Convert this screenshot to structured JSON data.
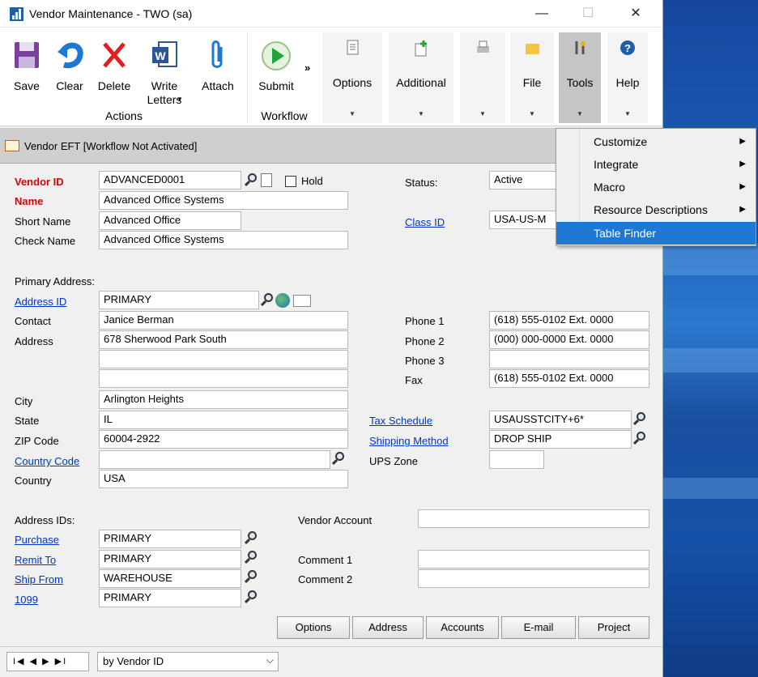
{
  "window": {
    "title": "Vendor Maintenance  -  TWO (sa)",
    "min": "—",
    "max": "☐",
    "close": "✕"
  },
  "ribbon": {
    "save": "Save",
    "clear": "Clear",
    "delete": "Delete",
    "write_letters": "Write Letters",
    "attach": "Attach",
    "actions_group": "Actions",
    "submit": "Submit",
    "workflow_group": "Workflow",
    "more": "»",
    "options": "Options",
    "additional": "Additional",
    "file": "File",
    "tools": "Tools",
    "help": "Help"
  },
  "status_bar": {
    "text": "Vendor EFT [Workflow Not Activated]"
  },
  "form": {
    "vendor_id_label": "Vendor ID",
    "vendor_id": "ADVANCED0001",
    "hold_label": "Hold",
    "name_label": "Name",
    "name": "Advanced Office Systems",
    "short_name_label": "Short Name",
    "short_name": "Advanced Office",
    "check_name_label": "Check Name",
    "check_name": "Advanced Office Systems",
    "status_label": "Status:",
    "status": "Active",
    "class_id_label": "Class ID",
    "class_id": "USA-US-M",
    "primary_address_label": "Primary Address:",
    "address_id_label": "Address ID",
    "address_id": "PRIMARY",
    "contact_label": "Contact",
    "contact": "Janice Berman",
    "address_label": "Address",
    "address1": "678 Sherwood Park South",
    "address2": "",
    "address3": "",
    "city_label": "City",
    "city": "Arlington Heights",
    "state_label": "State",
    "state": "IL",
    "zip_label": "ZIP Code",
    "zip": "60004-2922",
    "country_code_label": "Country Code",
    "country_code": "",
    "country_label": "Country",
    "country": "USA",
    "phone1_label": "Phone 1",
    "phone1": "(618) 555-0102  Ext. 0000",
    "phone2_label": "Phone 2",
    "phone2": "(000) 000-0000  Ext. 0000",
    "phone3_label": "Phone 3",
    "phone3": "",
    "fax_label": "Fax",
    "fax": "(618) 555-0102  Ext. 0000",
    "tax_schedule_label": "Tax Schedule",
    "tax_schedule": "USAUSSTCITY+6*",
    "shipping_method_label": "Shipping Method",
    "shipping_method": "DROP SHIP",
    "ups_zone_label": "UPS Zone",
    "ups_zone": "",
    "address_ids_label": "Address IDs:",
    "purchase_label": "Purchase",
    "purchase": "PRIMARY",
    "remit_to_label": "Remit To",
    "remit_to": "PRIMARY",
    "ship_from_label": "Ship From",
    "ship_from": "WAREHOUSE",
    "t1099_label": "1099",
    "t1099": "PRIMARY",
    "vendor_account_label": "Vendor Account",
    "vendor_account": "",
    "comment1_label": "Comment 1",
    "comment1": "",
    "comment2_label": "Comment 2",
    "comment2": ""
  },
  "buttons": {
    "options": "Options",
    "address": "Address",
    "accounts": "Accounts",
    "email": "E-mail",
    "project": "Project"
  },
  "navigation": {
    "controls": "I◀ ◀ ▶ ▶I",
    "sort_by": "by Vendor ID"
  },
  "tools_menu": {
    "items": [
      {
        "label": "Customize",
        "submenu": true
      },
      {
        "label": "Integrate",
        "submenu": true
      },
      {
        "label": "Macro",
        "submenu": true
      },
      {
        "label": "Resource Descriptions",
        "submenu": true
      },
      {
        "label": "Table Finder",
        "submenu": false,
        "selected": true
      }
    ]
  }
}
